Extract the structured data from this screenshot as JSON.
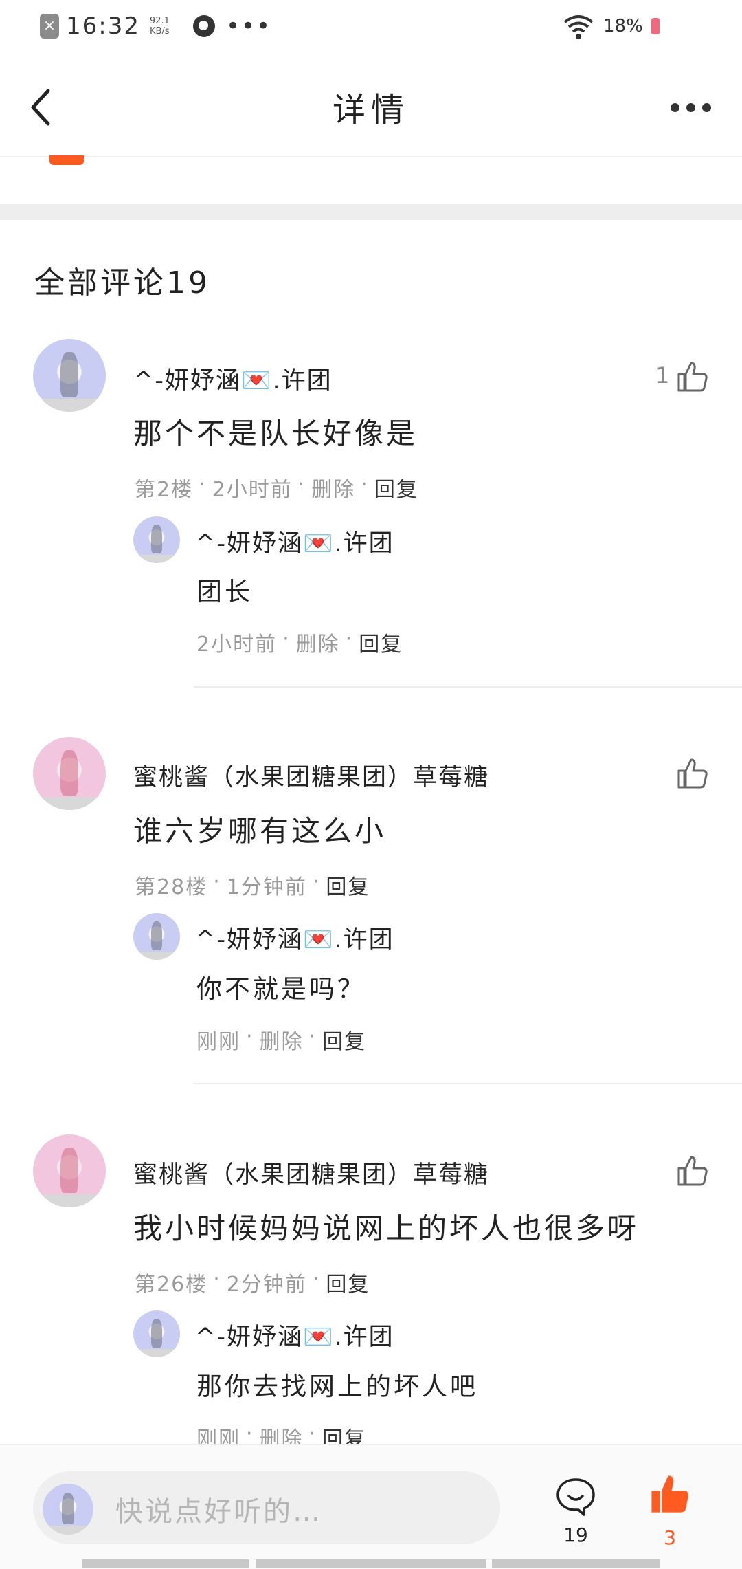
{
  "status_bar": {
    "time": "16:32",
    "speed_value": "92.1",
    "speed_unit": "KB/s",
    "battery": "18%"
  },
  "header": {
    "title": "详情"
  },
  "comments_section": {
    "title": "全部评论19"
  },
  "comments": [
    {
      "user": "^-妍妤涵💌.许团",
      "text": "那个不是队长好像是",
      "floor": "第2楼",
      "time": "2小时前",
      "delete": "删除",
      "reply": "回复",
      "likes": "1",
      "sub": {
        "user": "^-妍妤涵💌.许团",
        "text": "团长",
        "time": "2小时前",
        "delete": "删除",
        "reply": "回复"
      }
    },
    {
      "user": "蜜桃酱（水果团糖果团）草莓糖",
      "text": "谁六岁哪有这么小",
      "floor": "第28楼",
      "time": "1分钟前",
      "reply": "回复",
      "sub": {
        "user": "^-妍妤涵💌.许团",
        "text": "你不就是吗？",
        "time": "刚刚",
        "delete": "删除",
        "reply": "回复"
      }
    },
    {
      "user": "蜜桃酱（水果团糖果团）草莓糖",
      "text": "我小时候妈妈说网上的坏人也很多呀",
      "floor": "第26楼",
      "time": "2分钟前",
      "reply": "回复",
      "sub": {
        "user": "^-妍妤涵💌.许团",
        "text": "那你去找网上的坏人吧",
        "time": "刚刚",
        "delete": "删除",
        "reply": "回复"
      }
    }
  ],
  "bottom_bar": {
    "placeholder": "快说点好听的…",
    "comment_count": "19",
    "like_count": "3"
  },
  "colors": {
    "accent": "#ff5a1f",
    "meta": "#9a9a9a",
    "divider": "#eeeeee"
  },
  "icons": [
    "close-icon",
    "qq-icon",
    "wifi-icon",
    "battery-icon",
    "back-icon",
    "more-icon",
    "thumbs-up-icon",
    "comment-icon"
  ]
}
